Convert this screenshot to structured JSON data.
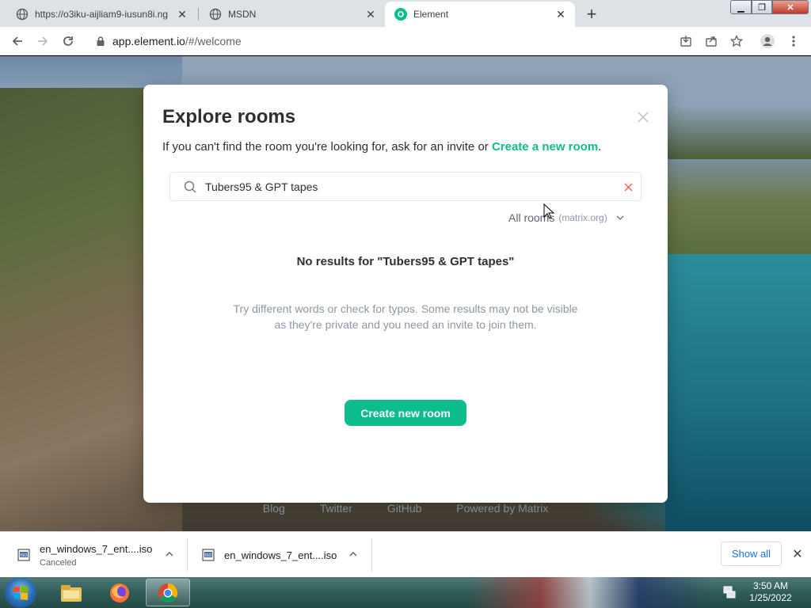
{
  "browser": {
    "tabs": [
      {
        "title": "https://o3iku-aijliam9-iusun8i.ng",
        "active": false
      },
      {
        "title": "MSDN",
        "active": false
      },
      {
        "title": "Element",
        "active": true
      }
    ],
    "url_host": "app.element.io",
    "url_path": "/#/welcome"
  },
  "page": {
    "footer_links": [
      "Blog",
      "Twitter",
      "GitHub",
      "Powered by Matrix"
    ]
  },
  "dialog": {
    "title": "Explore rooms",
    "subtitle_prefix": "If you can't find the room you're looking for, ask for an invite or ",
    "subtitle_link": "Create a new room",
    "subtitle_suffix": ".",
    "search_value": "Tubers95 & GPT tapes",
    "server_label": "All rooms",
    "server_name": "(matrix.org)",
    "no_results": "No results for \"Tubers95 & GPT tapes\"",
    "hint": "Try different words or check for typos. Some results may not be visible as they're private and you need an invite to join them.",
    "create_button": "Create new room",
    "accent_color": "#0dbd8b"
  },
  "downloads": {
    "items": [
      {
        "name": "en_windows_7_ent....iso",
        "status": "Canceled"
      },
      {
        "name": "en_windows_7_ent....iso",
        "status": ""
      }
    ],
    "show_all": "Show all"
  },
  "taskbar": {
    "time": "3:50 AM",
    "date": "1/25/2022",
    "apps": [
      "file-explorer-icon",
      "firefox-icon",
      "chrome-icon"
    ]
  }
}
